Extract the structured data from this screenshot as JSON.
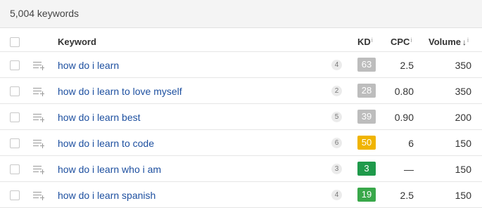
{
  "summary": {
    "text": "5,004 keywords"
  },
  "header": {
    "keyword": "Keyword",
    "kd": "KD",
    "cpc": "CPC",
    "volume": "Volume",
    "info_mark": "i",
    "sort_arrow": "↓"
  },
  "rows": [
    {
      "keyword": "how do i learn",
      "serp": "4",
      "kd": "63",
      "kd_color": "#bdbdbd",
      "cpc": "2.5",
      "volume": "350"
    },
    {
      "keyword": "how do i learn to love myself",
      "serp": "2",
      "kd": "28",
      "kd_color": "#bdbdbd",
      "cpc": "0.80",
      "volume": "350"
    },
    {
      "keyword": "how do i learn best",
      "serp": "5",
      "kd": "39",
      "kd_color": "#bdbdbd",
      "cpc": "0.90",
      "volume": "200"
    },
    {
      "keyword": "how do i learn to code",
      "serp": "6",
      "kd": "50",
      "kd_color": "#f0b400",
      "cpc": "6",
      "volume": "150"
    },
    {
      "keyword": "how do i learn who i am",
      "serp": "3",
      "kd": "3",
      "kd_color": "#1f9a4b",
      "cpc": "—",
      "volume": "150"
    },
    {
      "keyword": "how do i learn spanish",
      "serp": "4",
      "kd": "19",
      "kd_color": "#39a84a",
      "cpc": "2.5",
      "volume": "150"
    }
  ],
  "icons": {
    "row_action": "add-to-list-icon",
    "sort": "sort-desc-icon",
    "info": "info-icon"
  }
}
